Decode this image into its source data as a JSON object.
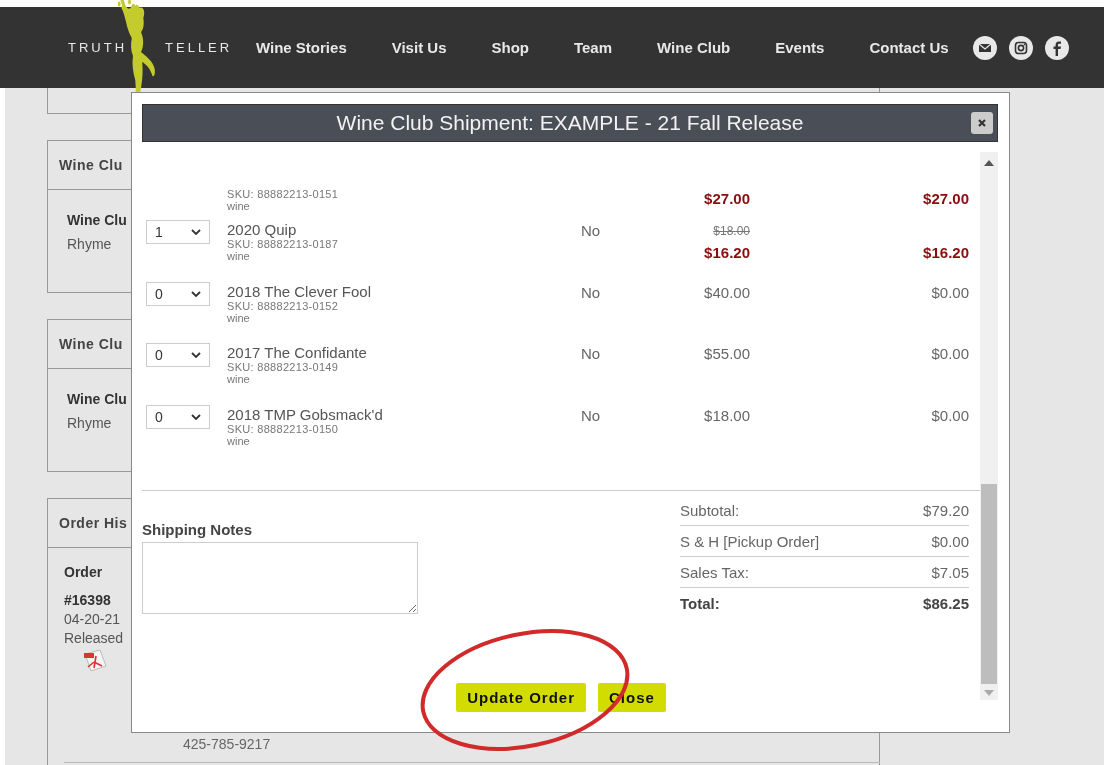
{
  "nav": {
    "logo": {
      "word_1": "TRUTH",
      "word_2": "TELLER"
    },
    "links": [
      "Wine Stories",
      "Visit Us",
      "Shop",
      "Team",
      "Wine Club",
      "Events",
      "Contact Us"
    ]
  },
  "background": {
    "cards": [
      {
        "heading": "Wine Clu",
        "label": "Wine Clu",
        "value": "Rhyme"
      },
      {
        "heading": "Wine Clu",
        "label": "Wine Clu",
        "value": "Rhyme"
      }
    ],
    "order_history": {
      "heading": "Order His",
      "column": "Order",
      "number": "#16398",
      "date": "04-20-21",
      "status": "Released",
      "phone": "425-785-9217"
    }
  },
  "modal": {
    "title": "Wine Club Shipment: EXAMPLE - 21 Fall Release",
    "items": [
      {
        "sku": "SKU: 88882213-0151",
        "type": "wine",
        "price": "$27.00",
        "total": "$27.00",
        "discounted": true
      },
      {
        "quantity": "1",
        "name": "2020 Quip",
        "sku": "SKU: 88882213-0187",
        "type": "wine",
        "column_3": "No",
        "original_price": "$18.00",
        "price": "$16.20",
        "total": "$16.20",
        "discounted": true
      },
      {
        "quantity": "0",
        "name": "2018 The Clever Fool",
        "sku": "SKU: 88882213-0152",
        "type": "wine",
        "column_3": "No",
        "price": "$40.00",
        "total": "$0.00",
        "discounted": false
      },
      {
        "quantity": "0",
        "name": "2017 The Confidante",
        "sku": "SKU: 88882213-0149",
        "type": "wine",
        "column_3": "No",
        "price": "$55.00",
        "total": "$0.00",
        "discounted": false
      },
      {
        "quantity": "0",
        "name": "2018 TMP Gobsmack'd",
        "sku": "SKU: 88882213-0150",
        "type": "wine",
        "column_3": "No",
        "price": "$18.00",
        "total": "$0.00",
        "discounted": false
      }
    ],
    "shipping_notes": {
      "label": "Shipping Notes"
    },
    "totals": [
      {
        "kind": "line",
        "label": "Subtotal:",
        "value": "$79.20"
      },
      {
        "kind": "line",
        "label": "S & H [Pickup Order]",
        "value": "$0.00"
      },
      {
        "kind": "line",
        "label": "Sales Tax:",
        "value": "$7.05"
      },
      {
        "kind": "total",
        "label": "Total:",
        "value": "$86.25"
      }
    ],
    "buttons": [
      "Update Order",
      "Close"
    ]
  }
}
